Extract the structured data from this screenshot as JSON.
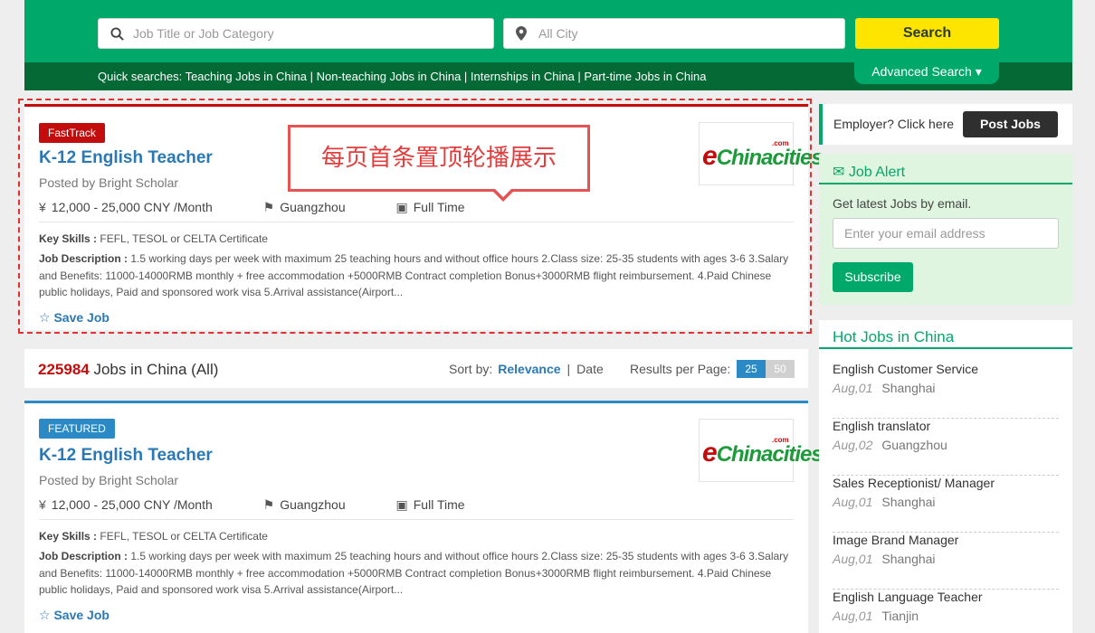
{
  "header": {
    "job_placeholder": "Job Title or Job Category",
    "city_placeholder": "All City",
    "search_label": "Search",
    "quick_searches": "Quick searches: Teaching Jobs in China | Non-teaching Jobs in China | Internships in China | Part-time Jobs in China",
    "advanced_label": "Advanced Search ▾"
  },
  "callout": "每页首条置顶轮播展示",
  "cards": [
    {
      "badge": "FastTrack",
      "title": "K-12 English Teacher",
      "posted": "Posted by Bright Scholar",
      "salary": "12,000 - 25,000 CNY /Month",
      "location": "Guangzhou",
      "type": "Full Time",
      "skills_label": "Key Skills :",
      "skills": " FEFL, TESOL or CELTA Certificate",
      "desc_label": "Job Description :",
      "desc": " 1.5 working days per week with maximum 25 teaching hours and without office hours 2.Class size: 25-35 students with ages 3-6 3.Salary and Benefits: 11000-14000RMB monthly + free accommodation +5000RMB Contract completion Bonus+3000RMB flight reimbursement. 4.Paid Chinese public holidays, Paid and sponsored work visa 5.Arrival assistance(Airport...",
      "save_label": "Save Job"
    },
    {
      "badge": "FEATURED",
      "title": "K-12 English Teacher",
      "posted": "Posted by Bright Scholar",
      "salary": "12,000 - 25,000 CNY /Month",
      "location": "Guangzhou",
      "type": "Full Time",
      "skills_label": "Key Skills :",
      "skills": " FEFL, TESOL or CELTA Certificate",
      "desc_label": "Job Description :",
      "desc": " 1.5 working days per week with maximum 25 teaching hours and without office hours 2.Class size: 25-35 students with ages 3-6 3.Salary and Benefits: 11000-14000RMB monthly + free accommodation +5000RMB Contract completion Bonus+3000RMB flight reimbursement. 4.Paid Chinese public holidays, Paid and sponsored work visa 5.Arrival assistance(Airport...",
      "save_label": "Save Job"
    }
  ],
  "logo": {
    "e": "e",
    "rest": "Chinacities",
    "com": ".com"
  },
  "results": {
    "count": "225984",
    "suffix": " Jobs in China (All)",
    "sort_label": "Sort by:",
    "sort_relevance": "Relevance",
    "sort_sep": "|",
    "sort_date": "Date",
    "rpp_label": "Results per Page:",
    "rpp_25": "25",
    "rpp_50": "50"
  },
  "sidebar": {
    "employer_text": "Employer? Click here",
    "post_jobs": "Post Jobs",
    "alert_title": "Job Alert",
    "alert_desc": "Get latest Jobs by email.",
    "email_placeholder": "Enter your email address",
    "subscribe": "Subscribe",
    "hot_title": "Hot Jobs in China",
    "hot_jobs": [
      {
        "title": "English Customer Service",
        "date": "Aug,01",
        "city": "Shanghai"
      },
      {
        "title": "English translator",
        "date": "Aug,02",
        "city": "Guangzhou"
      },
      {
        "title": "Sales Receptionist/ Manager",
        "date": "Aug,01",
        "city": "Shanghai"
      },
      {
        "title": "Image Brand Manager",
        "date": "Aug,01",
        "city": "Shanghai"
      },
      {
        "title": "English Language Teacher",
        "date": "Aug,01",
        "city": "Tianjin"
      }
    ]
  },
  "colors": {
    "brand_green": "#00a96a",
    "dark_green": "#046934",
    "fasttrack_red": "#c30d0d",
    "featured_blue": "#2b8ac6",
    "search_yellow": "#fde500"
  }
}
